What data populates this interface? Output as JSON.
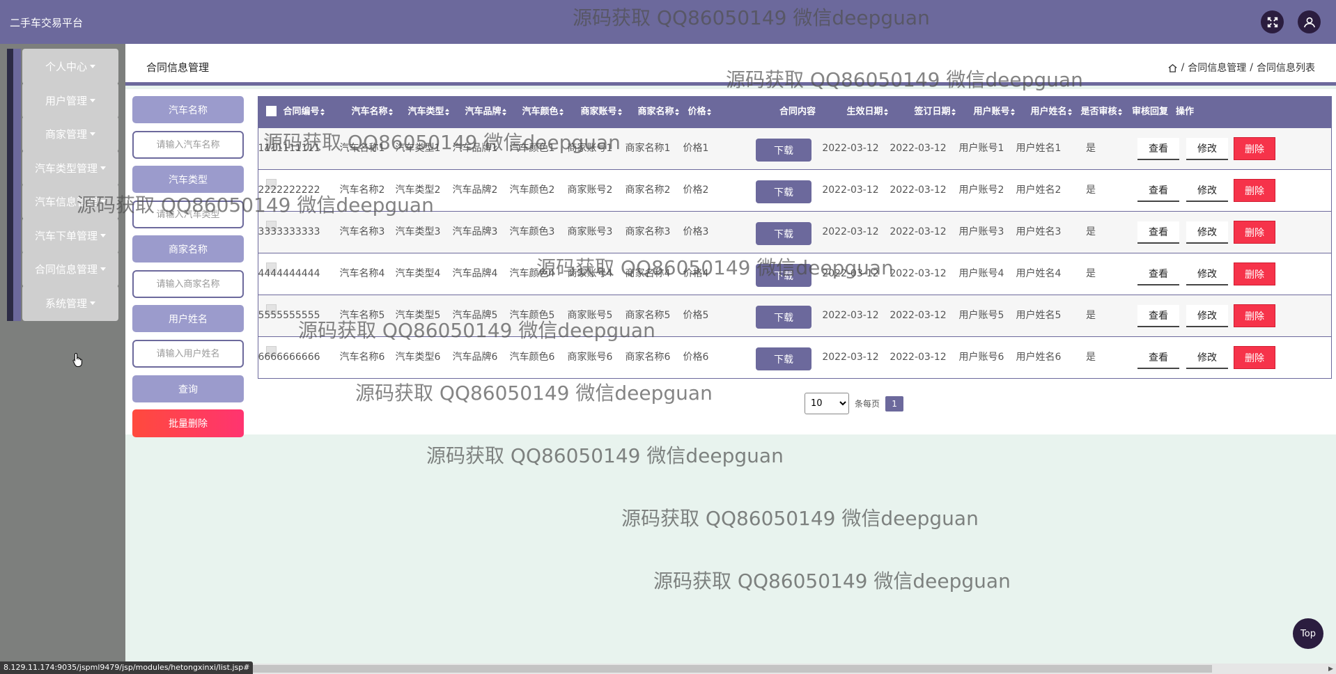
{
  "header": {
    "app_title": "二手车交易平台",
    "icons": [
      "fullscreen-icon",
      "user-icon"
    ]
  },
  "sidebar": {
    "items": [
      {
        "label": "个人中心"
      },
      {
        "label": "用户管理"
      },
      {
        "label": "商家管理"
      },
      {
        "label": "汽车类型管理"
      },
      {
        "label": "汽车信息管理"
      },
      {
        "label": "汽车下单管理"
      },
      {
        "label": "合同信息管理"
      },
      {
        "label": "系统管理"
      }
    ]
  },
  "page": {
    "title": "合同信息管理",
    "breadcrumb": [
      "合同信息管理",
      "合同信息列表"
    ],
    "breadcrumb_sep": "/"
  },
  "search": {
    "car_name_label": "汽车名称",
    "car_name_placeholder": "请输入汽车名称",
    "car_type_label": "汽车类型",
    "car_type_placeholder": "请输入汽车类型",
    "merchant_name_label": "商家名称",
    "merchant_name_placeholder": "请输入商家名称",
    "user_name_label": "用户姓名",
    "user_name_placeholder": "请输入用户姓名",
    "query_label": "查询",
    "batch_delete_label": "批量删除"
  },
  "table": {
    "columns": [
      "合同编号",
      "汽车名称",
      "汽车类型",
      "汽车品牌",
      "汽车颜色",
      "商家账号",
      "商家名称",
      "价格",
      "合同内容",
      "生效日期",
      "签订日期",
      "用户账号",
      "用户姓名",
      "是否审核",
      "审核回复",
      "操作"
    ],
    "download_label": "下载",
    "view_label": "查看",
    "edit_label": "修改",
    "delete_label": "删除",
    "rows": [
      {
        "no": "1111111111",
        "car_name": "汽车名称1",
        "car_type": "汽车类型1",
        "brand": "汽车品牌1",
        "color": "汽车颜色1",
        "merchant_account": "商家账号1",
        "merchant_name": "商家名称1",
        "price": "价格1",
        "effective_date": "2022-03-12",
        "sign_date": "2022-03-12",
        "user_account": "用户账号1",
        "user_name": "用户姓名1",
        "reviewed": "是",
        "reply": ""
      },
      {
        "no": "2222222222",
        "car_name": "汽车名称2",
        "car_type": "汽车类型2",
        "brand": "汽车品牌2",
        "color": "汽车颜色2",
        "merchant_account": "商家账号2",
        "merchant_name": "商家名称2",
        "price": "价格2",
        "effective_date": "2022-03-12",
        "sign_date": "2022-03-12",
        "user_account": "用户账号2",
        "user_name": "用户姓名2",
        "reviewed": "是",
        "reply": ""
      },
      {
        "no": "3333333333",
        "car_name": "汽车名称3",
        "car_type": "汽车类型3",
        "brand": "汽车品牌3",
        "color": "汽车颜色3",
        "merchant_account": "商家账号3",
        "merchant_name": "商家名称3",
        "price": "价格3",
        "effective_date": "2022-03-12",
        "sign_date": "2022-03-12",
        "user_account": "用户账号3",
        "user_name": "用户姓名3",
        "reviewed": "是",
        "reply": ""
      },
      {
        "no": "4444444444",
        "car_name": "汽车名称4",
        "car_type": "汽车类型4",
        "brand": "汽车品牌4",
        "color": "汽车颜色4",
        "merchant_account": "商家账号4",
        "merchant_name": "商家名称4",
        "price": "价格4",
        "effective_date": "2022-03-12",
        "sign_date": "2022-03-12",
        "user_account": "用户账号4",
        "user_name": "用户姓名4",
        "reviewed": "是",
        "reply": ""
      },
      {
        "no": "5555555555",
        "car_name": "汽车名称5",
        "car_type": "汽车类型5",
        "brand": "汽车品牌5",
        "color": "汽车颜色5",
        "merchant_account": "商家账号5",
        "merchant_name": "商家名称5",
        "price": "价格5",
        "effective_date": "2022-03-12",
        "sign_date": "2022-03-12",
        "user_account": "用户账号5",
        "user_name": "用户姓名5",
        "reviewed": "是",
        "reply": ""
      },
      {
        "no": "6666666666",
        "car_name": "汽车名称6",
        "car_type": "汽车类型6",
        "brand": "汽车品牌6",
        "color": "汽车颜色6",
        "merchant_account": "商家账号6",
        "merchant_name": "商家名称6",
        "price": "价格6",
        "effective_date": "2022-03-12",
        "sign_date": "2022-03-12",
        "user_account": "用户账号6",
        "user_name": "用户姓名6",
        "reviewed": "是",
        "reply": ""
      }
    ]
  },
  "pagination": {
    "page_size": "10",
    "page_size_options": [
      "10"
    ],
    "per_page_label": "条每页",
    "current_page": "1"
  },
  "watermark": "源码获取 QQ86050149 微信deepguan",
  "status_url": "8.129.11.174:9035/jspml9479/jsp/modules/hetongxinxi/list.jsp#",
  "top_button_label": "Top",
  "colors": {
    "accent": "#6c699c",
    "danger": "#f6334a",
    "sidebar_bg": "#7d7f7d",
    "page_bg": "#e8f3ee"
  }
}
